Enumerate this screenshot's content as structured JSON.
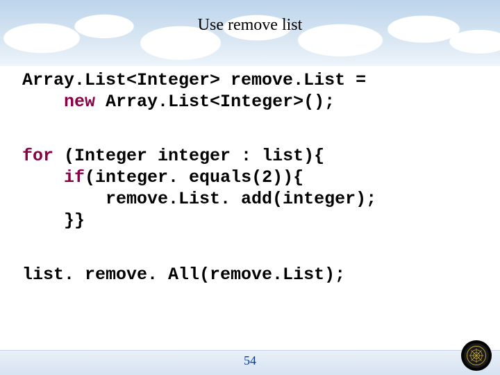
{
  "title": "Use remove list",
  "code": {
    "block1": {
      "p1": "Array.List<Integer> remove.List =",
      "p2_indent": "    ",
      "p2_kw": "new",
      "p2_rest": " Array.List<Integer>();"
    },
    "block2": {
      "l1_kw": "for",
      "l1_rest": " (Integer integer : list){",
      "l2_indent": "    ",
      "l2_kw": "if",
      "l2_rest": "(integer. equals(2)){",
      "l3": "        remove.List. add(integer);",
      "l4": "    }}"
    },
    "block3": {
      "l1": "list. remove. All(remove.List);"
    }
  },
  "page_number": "54",
  "logo_name": "institution-seal"
}
